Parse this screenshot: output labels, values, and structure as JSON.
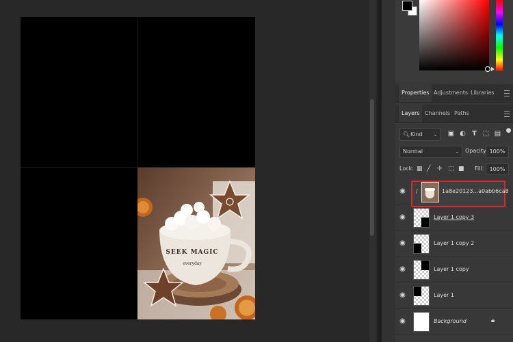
{
  "panels": {
    "top_tabs": [
      "Properties",
      "Adjustments",
      "Libraries"
    ],
    "layer_tabs": [
      "Layers",
      "Channels",
      "Paths"
    ]
  },
  "layers_panel": {
    "filter_label": "Kind",
    "blend_mode": "Normal",
    "opacity_label": "Opacity:",
    "opacity_value": "100%",
    "lock_label": "Lock:",
    "fill_label": "Fill:",
    "fill_value": "100%",
    "layers": [
      {
        "name": "1a8e20123...a0abb6ca8",
        "selected": true
      },
      {
        "name": "Layer 1 copy 3"
      },
      {
        "name": "Layer 1 copy 2"
      },
      {
        "name": "Layer 1 copy"
      },
      {
        "name": "Layer 1"
      },
      {
        "name": "Background",
        "locked": true
      }
    ]
  },
  "image_text": {
    "mug_line1": "SEEK MAGIC",
    "mug_line2": "everyday"
  },
  "colors": {
    "selection_outline": "#e0262d",
    "panel_bg": "#383838",
    "canvas_bg": "#282828"
  },
  "icons": [
    "search-icon",
    "image-filter-icon",
    "adjustment-filter-icon",
    "type-filter-icon",
    "shape-filter-icon",
    "smart-object-filter-icon",
    "eye-icon",
    "lock-icon",
    "link-icon",
    "panel-menu-icon"
  ]
}
